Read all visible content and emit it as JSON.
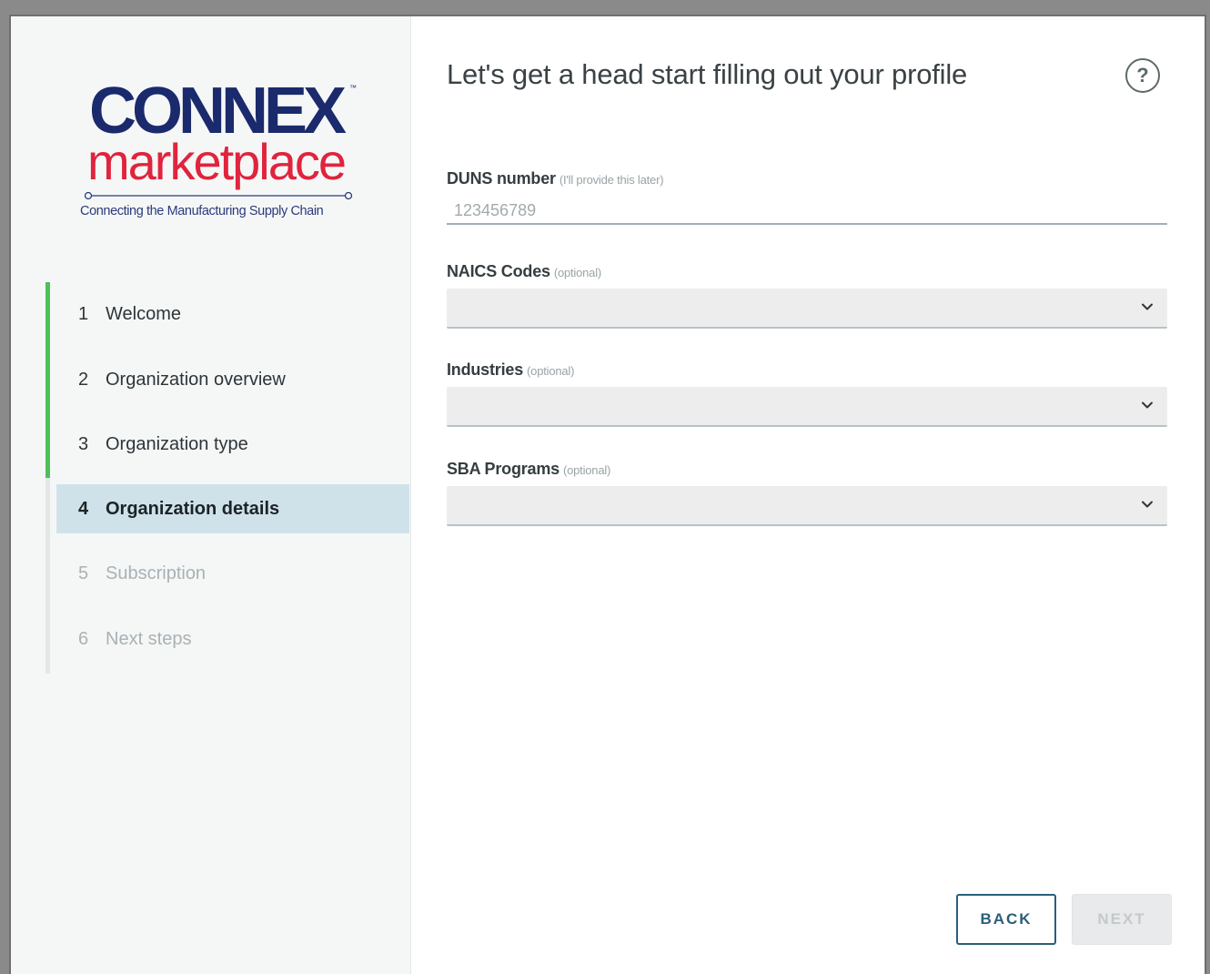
{
  "logo": {
    "brand": "CONNEX",
    "trademark": "™",
    "product": "marketplace",
    "tagline": "Connecting the Manufacturing Supply Chain"
  },
  "steps": [
    {
      "num": "1",
      "label": "Welcome",
      "state": "completed"
    },
    {
      "num": "2",
      "label": "Organization overview",
      "state": "completed"
    },
    {
      "num": "3",
      "label": "Organization type",
      "state": "completed"
    },
    {
      "num": "4",
      "label": "Organization details",
      "state": "active"
    },
    {
      "num": "5",
      "label": "Subscription",
      "state": "disabled"
    },
    {
      "num": "6",
      "label": "Next steps",
      "state": "disabled"
    }
  ],
  "progress": {
    "completed_steps": 3,
    "total_steps": 6
  },
  "main": {
    "title": "Let's get a head start filling out your profile",
    "help_icon": "question-circle-icon",
    "help_symbol": "?"
  },
  "form": {
    "duns": {
      "label": "DUNS number",
      "hint": "(I'll provide this later)",
      "placeholder": "123456789",
      "value": ""
    },
    "naics": {
      "label": "NAICS Codes",
      "hint": "(optional)",
      "value": ""
    },
    "industries": {
      "label": "Industries",
      "hint": "(optional)",
      "value": ""
    },
    "sba": {
      "label": "SBA Programs",
      "hint": "(optional)",
      "value": ""
    }
  },
  "buttons": {
    "back": "BACK",
    "next": "NEXT"
  },
  "colors": {
    "brand_navy": "#1a2a6c",
    "brand_red": "#e0243d",
    "progress_green": "#4cc05b",
    "active_step_bg": "#cfe2ea",
    "back_button": "#2a5e7a"
  }
}
